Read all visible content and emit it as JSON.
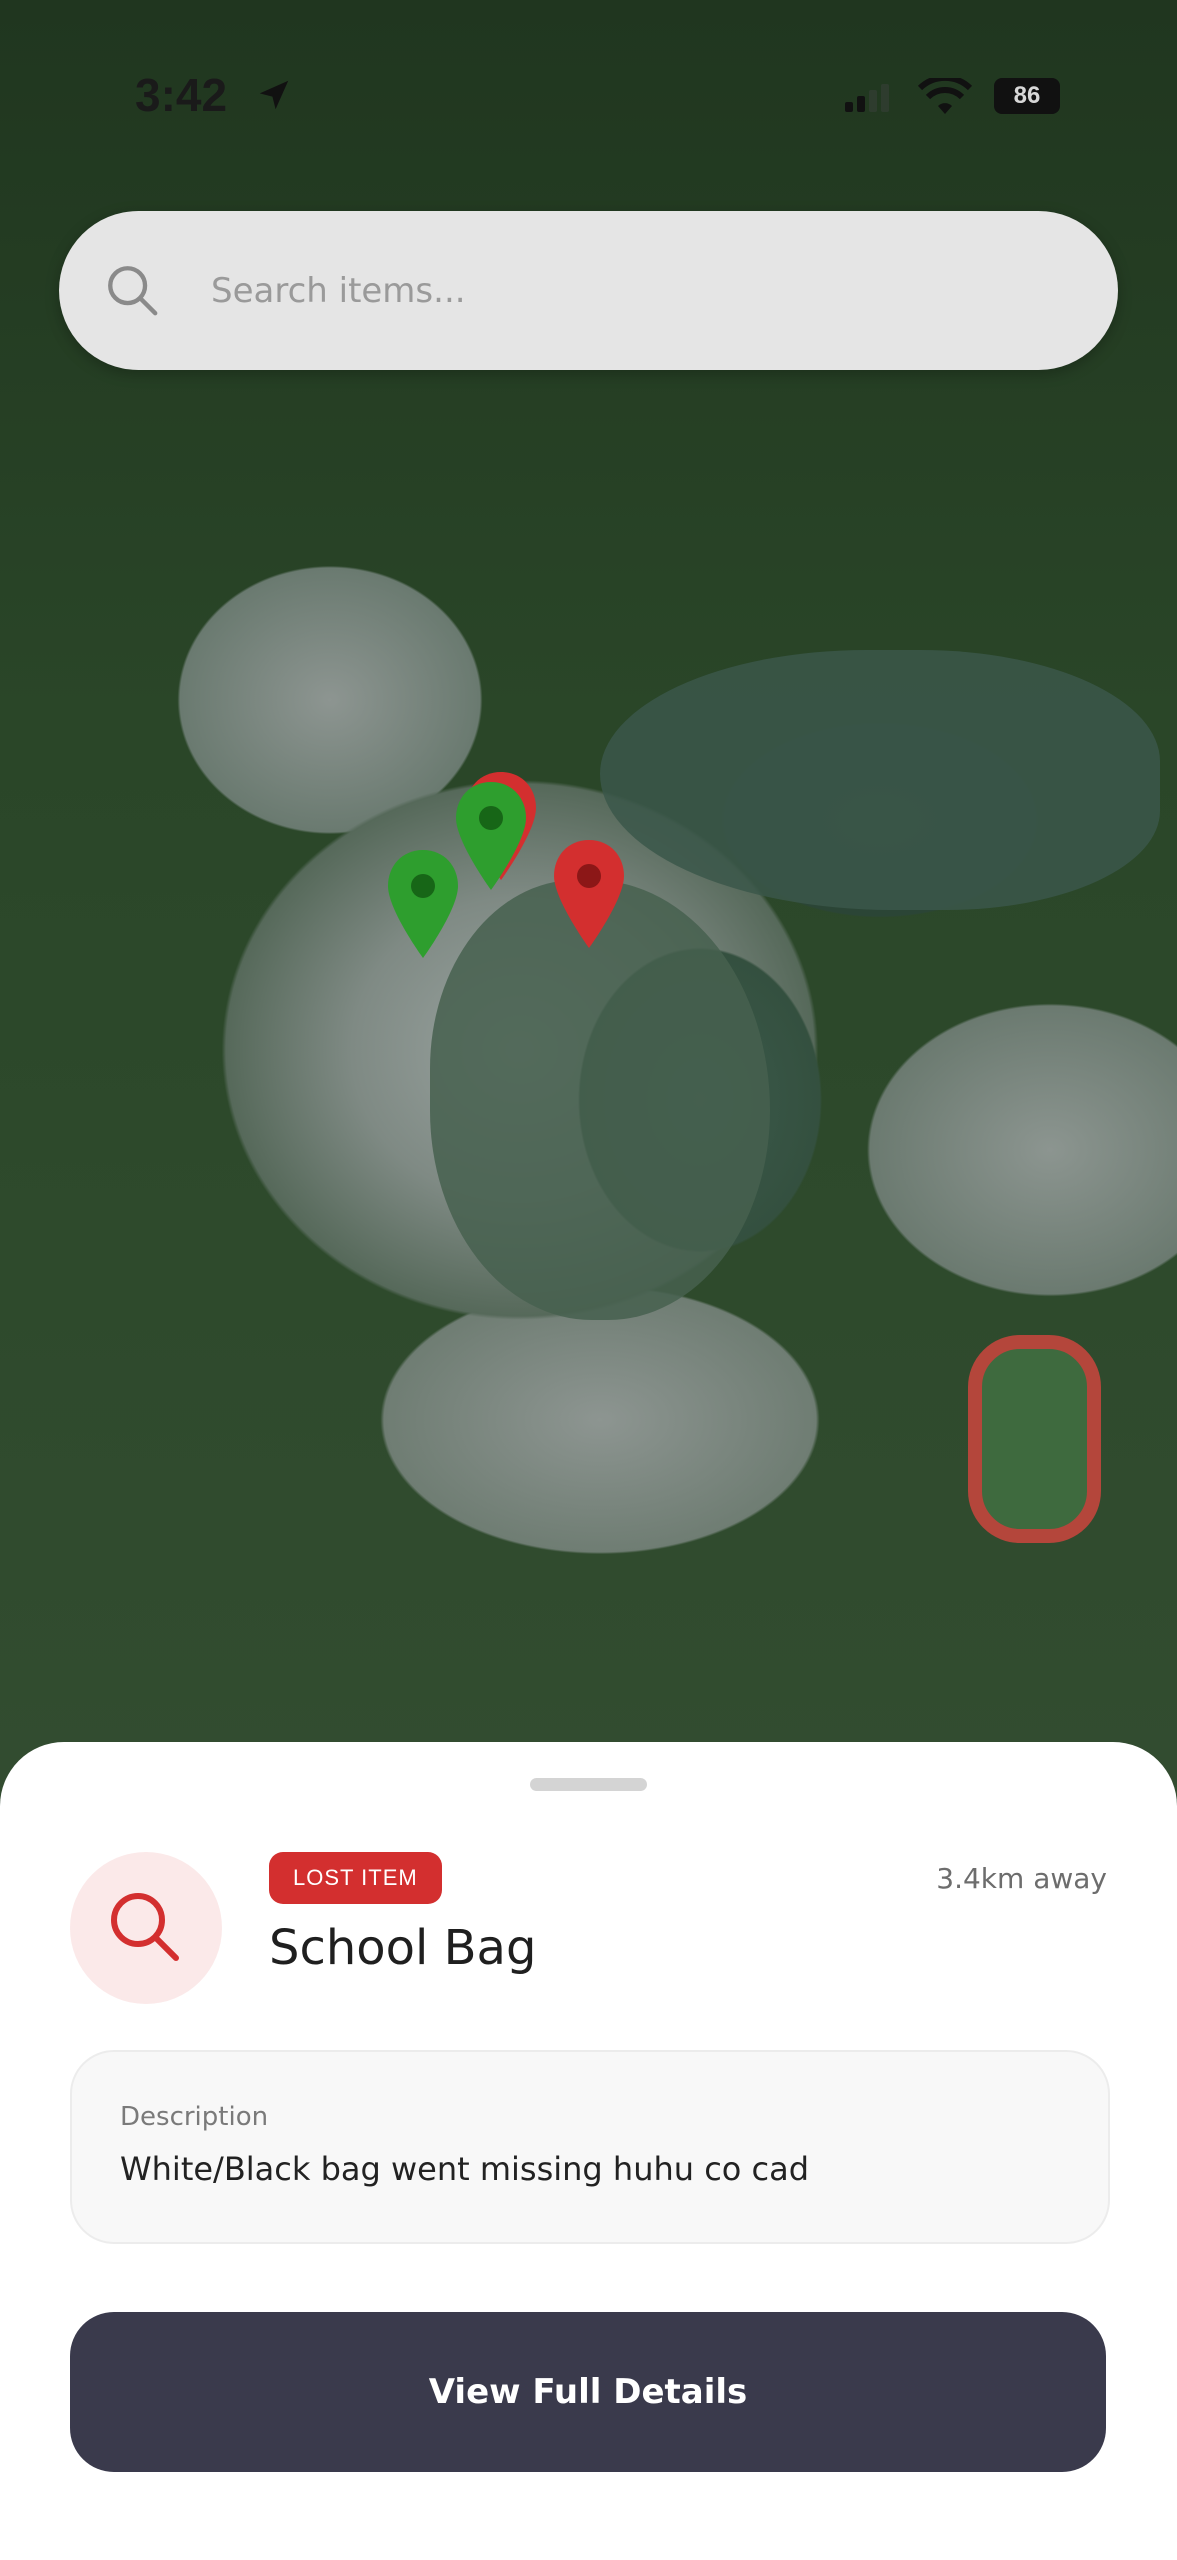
{
  "status_bar": {
    "time": "3:42",
    "battery": "86"
  },
  "search": {
    "placeholder": "Search items..."
  },
  "map": {
    "pins": [
      {
        "color": "#d32f2f",
        "type": "lost"
      },
      {
        "color": "#2e9e2e",
        "type": "found"
      },
      {
        "color": "#2e9e2e",
        "type": "found"
      },
      {
        "color": "#d32f2f",
        "type": "lost"
      }
    ]
  },
  "sheet": {
    "badge": "LOST ITEM",
    "title": "School Bag",
    "distance": "3.4km away",
    "description_label": "Description",
    "description": "White/Black bag went missing huhu co cad",
    "cta_label": "View Full Details"
  },
  "colors": {
    "accent_red": "#d32f2f",
    "button_dark": "#3a3a4c",
    "icon_bg": "#fbe9e9"
  }
}
